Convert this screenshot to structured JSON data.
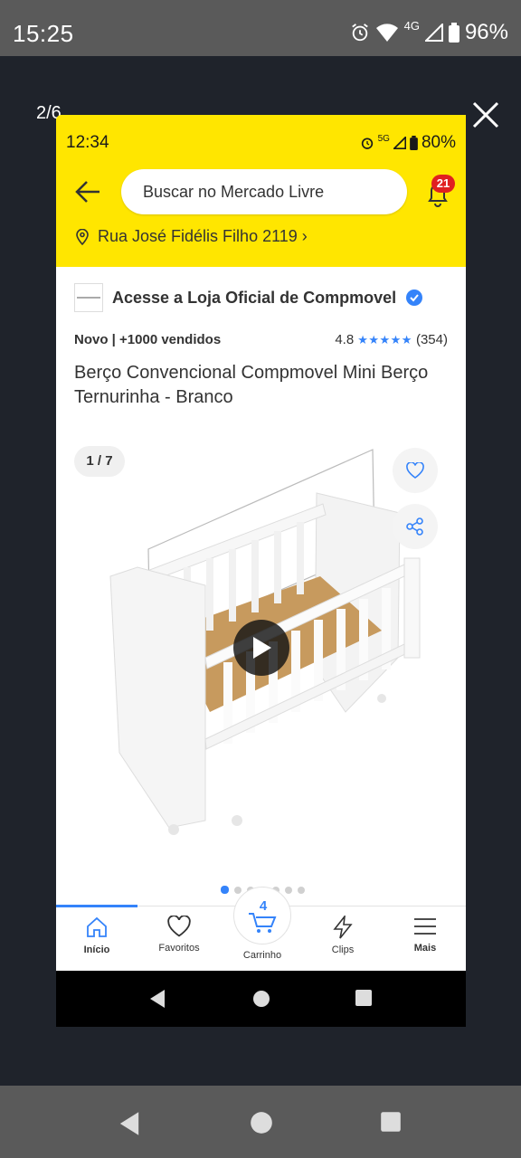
{
  "outer_status": {
    "time": "15:25",
    "network": "4G",
    "battery": "96%"
  },
  "viewer": {
    "counter": "2/6"
  },
  "inner_status": {
    "time": "12:34",
    "network": "5G",
    "battery": "80%"
  },
  "header": {
    "search_placeholder": "Buscar no Mercado Livre",
    "notification_count": "21",
    "address": "Rua José Fidélis Filho 2119 ›"
  },
  "store": {
    "text": "Acesse a Loja Oficial de Compmovel"
  },
  "product": {
    "condition": "Novo  |  +1000 vendidos",
    "rating": "4.8",
    "stars": "★★★★★",
    "reviews": "(354)",
    "title": "Berço Convencional Compmovel Mini Berço Ternurinha - Branco",
    "photo_index": "1 / 7"
  },
  "bottom_nav": {
    "items": [
      {
        "label": "Início",
        "icon": "home-icon"
      },
      {
        "label": "Favoritos",
        "icon": "heart-icon"
      },
      {
        "label": "Carrinho",
        "icon": "cart-icon"
      },
      {
        "label": "Clips",
        "icon": "clips-icon"
      },
      {
        "label": "Mais",
        "icon": "menu-icon"
      }
    ],
    "cart_count": "4"
  },
  "colors": {
    "header_yellow": "#ffe600",
    "accent_blue": "#3483fa",
    "badge_red": "#e02020"
  }
}
